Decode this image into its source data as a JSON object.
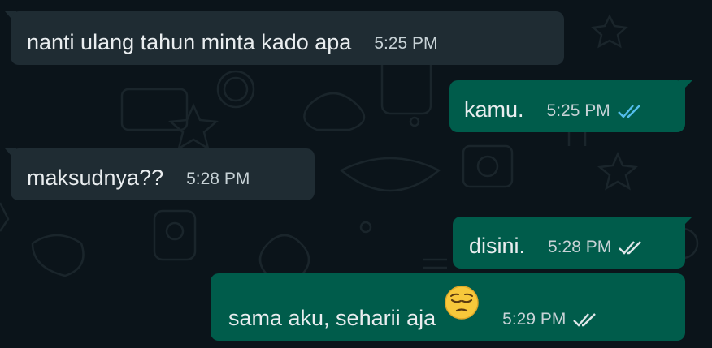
{
  "colors": {
    "background": "#0b141a",
    "incoming_bubble": "#1f2c33",
    "outgoing_bubble": "#005c4b",
    "read_ticks": "#53bdeb",
    "delivered_ticks": "#dfe6e9"
  },
  "messages": [
    {
      "direction": "incoming",
      "text": "nanti ulang tahun minta kado apa",
      "time": "5:25 PM"
    },
    {
      "direction": "outgoing",
      "text": "kamu.",
      "time": "5:25 PM",
      "status": "read",
      "status_icon": "double-check-icon"
    },
    {
      "direction": "incoming",
      "text": "maksudnya??",
      "time": "5:28 PM"
    },
    {
      "direction": "outgoing",
      "text": "disini.",
      "time": "5:28 PM",
      "status": "delivered",
      "status_icon": "double-check-icon"
    },
    {
      "direction": "outgoing",
      "text": "sama aku, seharii aja",
      "emoji": "pensive-face-emoji",
      "time": "5:29 PM",
      "status": "delivered",
      "status_icon": "double-check-icon"
    }
  ]
}
